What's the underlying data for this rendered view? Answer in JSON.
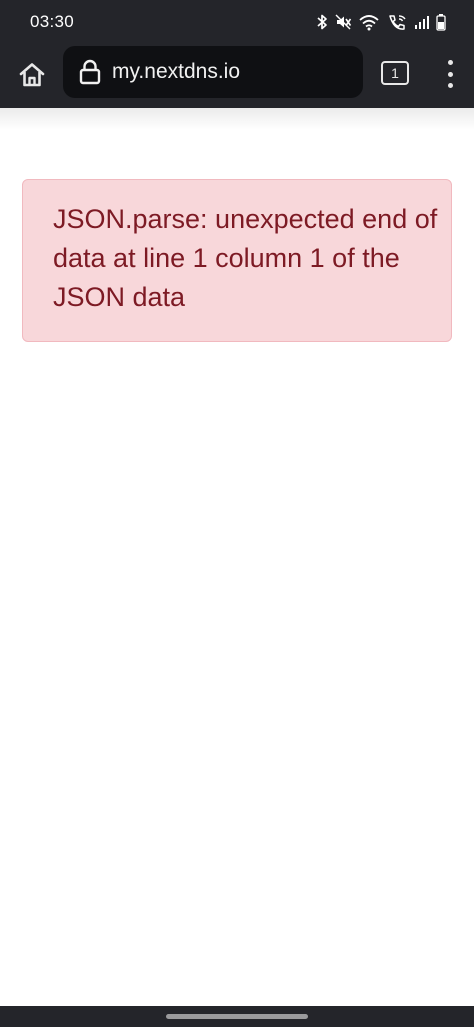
{
  "status_bar": {
    "time": "03:30",
    "icons": [
      "bluetooth-icon",
      "mute-icon",
      "wifi-icon",
      "wifi-calling-icon",
      "signal-icon",
      "battery-icon"
    ]
  },
  "toolbar": {
    "url": "my.nextdns.io",
    "tab_count": "1",
    "icons": [
      "home-icon",
      "lock-icon",
      "more-vert-icon"
    ]
  },
  "page": {
    "error_message": "JSON.parse: unexpected end of data at line 1 column 1 of the JSON data"
  },
  "colors": {
    "chrome_bg": "#24252a",
    "url_bar_bg": "#0f1013",
    "alert_bg": "#f8d7da",
    "alert_border": "#f1b9bf",
    "alert_text": "#7d1a24"
  }
}
